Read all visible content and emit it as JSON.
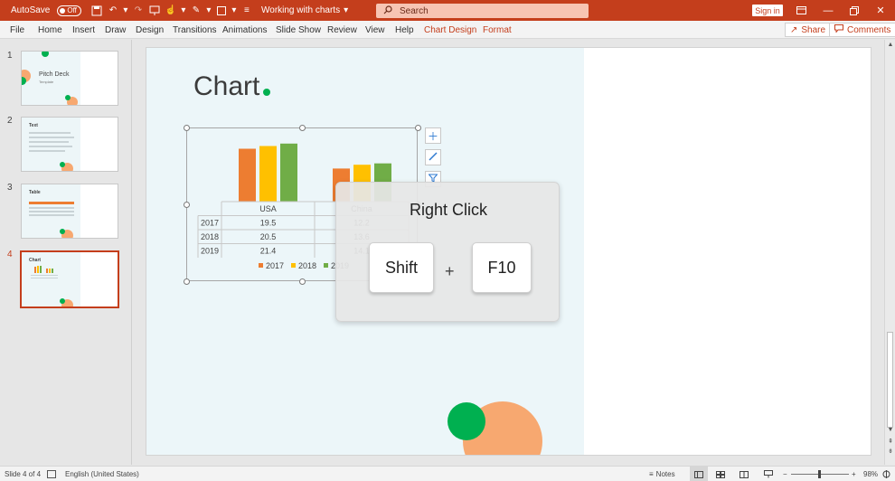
{
  "titlebar": {
    "autosave_label": "AutoSave",
    "autosave_state": "Off",
    "doc_title": "Working with charts",
    "search_placeholder": "Search",
    "signin_label": "Sign in"
  },
  "ribbon": {
    "tabs": [
      "File",
      "Home",
      "Insert",
      "Draw",
      "Design",
      "Transitions",
      "Animations",
      "Slide Show",
      "Review",
      "View",
      "Help",
      "Chart Design",
      "Format"
    ],
    "share_label": "Share",
    "comments_label": "Comments"
  },
  "thumbnails": [
    {
      "number": "1",
      "title": "Pitch Deck",
      "subtitle": "Template"
    },
    {
      "number": "2",
      "title": "Text"
    },
    {
      "number": "3",
      "title": "Table"
    },
    {
      "number": "4",
      "title": "Chart"
    }
  ],
  "slide": {
    "title": "Chart"
  },
  "chart_data": {
    "type": "bar",
    "categories": [
      "USA",
      "China"
    ],
    "series": [
      {
        "name": "2017",
        "values": [
          19.5,
          12.2
        ]
      },
      {
        "name": "2018",
        "values": [
          20.5,
          13.6
        ]
      },
      {
        "name": "2019",
        "values": [
          21.4,
          14.1
        ]
      }
    ],
    "legend": "bottom",
    "data_table": true,
    "colors": [
      "#ed7d31",
      "#ffc000",
      "#70ad47"
    ]
  },
  "overlay": {
    "title": "Right Click",
    "key1": "Shift",
    "plus": "+",
    "key2": "F10"
  },
  "status": {
    "slide_info": "Slide 4 of 4",
    "language": "English (United States)",
    "notes_label": "Notes",
    "zoom_minus": "−",
    "zoom_plus": "+",
    "zoom_level": "98%"
  },
  "colors": {
    "accent": "#c43e1c",
    "green": "#00b050",
    "orange": "#f7a870"
  }
}
